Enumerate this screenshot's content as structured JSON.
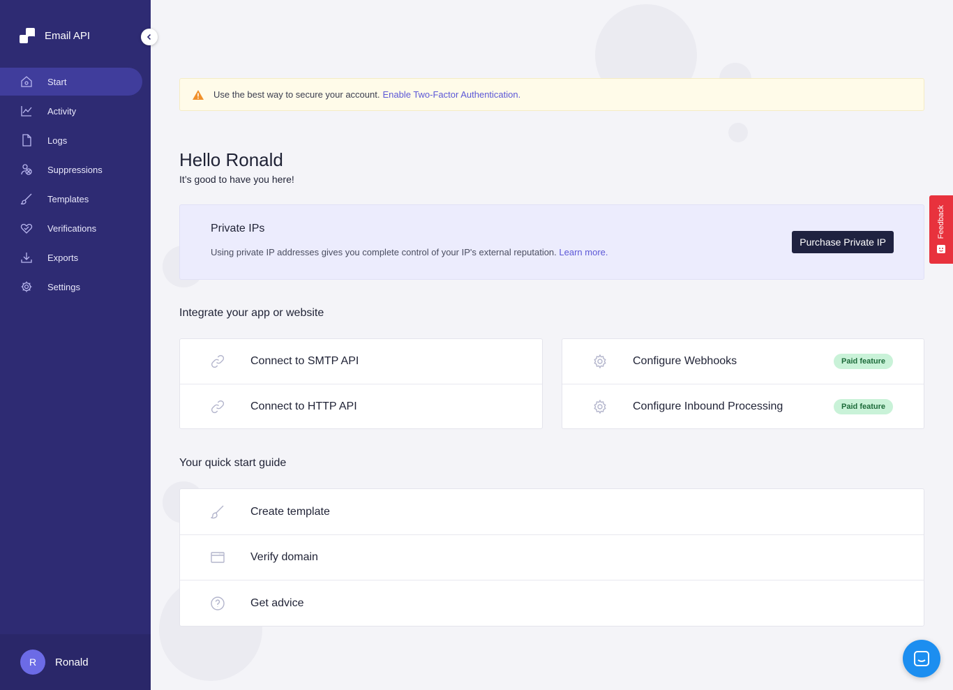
{
  "app": {
    "name": "Email API"
  },
  "nav": {
    "items": [
      {
        "label": "Start",
        "icon": "home-icon"
      },
      {
        "label": "Activity",
        "icon": "activity-chart-icon"
      },
      {
        "label": "Logs",
        "icon": "file-icon"
      },
      {
        "label": "Suppressions",
        "icon": "suppressions-icon"
      },
      {
        "label": "Templates",
        "icon": "brush-icon"
      },
      {
        "label": "Verifications",
        "icon": "verification-heart-icon"
      },
      {
        "label": "Exports",
        "icon": "download-icon"
      },
      {
        "label": "Settings",
        "icon": "gear-icon"
      }
    ],
    "active_index": 0
  },
  "user": {
    "initial": "R",
    "name": "Ronald"
  },
  "alert": {
    "text": "Use the best way to secure your account.",
    "link": "Enable Two-Factor Authentication."
  },
  "greeting": {
    "title": "Hello Ronald",
    "subtitle": "It’s good to have you here!"
  },
  "promo": {
    "title": "Private IPs",
    "text": "Using private IP addresses gives you complete control of your IP's external reputation.",
    "link": "Learn more.",
    "button": "Purchase Private IP"
  },
  "integrate": {
    "title": "Integrate your app or website",
    "left": [
      {
        "label": "Connect to SMTP API",
        "icon": "link-icon"
      },
      {
        "label": "Connect to HTTP API",
        "icon": "link-icon"
      }
    ],
    "right": [
      {
        "label": "Configure Webhooks",
        "icon": "gear-icon",
        "badge": "Paid feature"
      },
      {
        "label": "Configure Inbound Processing",
        "icon": "gear-icon",
        "badge": "Paid feature"
      }
    ]
  },
  "guide": {
    "title": "Your quick start guide",
    "items": [
      {
        "label": "Create template",
        "icon": "brush-icon"
      },
      {
        "label": "Verify domain",
        "icon": "browser-window-icon"
      },
      {
        "label": "Get advice",
        "icon": "question-circle-icon"
      }
    ]
  },
  "feedback": {
    "label": "Feedback"
  },
  "colors": {
    "sidebar": "#2e2b73",
    "sidebar_active": "#403d9c",
    "link": "#5b57d6",
    "alert_bg": "#fffbe9",
    "badge_bg": "#c9f2d8",
    "feedback": "#e8323d",
    "chat": "#1c8ef0"
  }
}
